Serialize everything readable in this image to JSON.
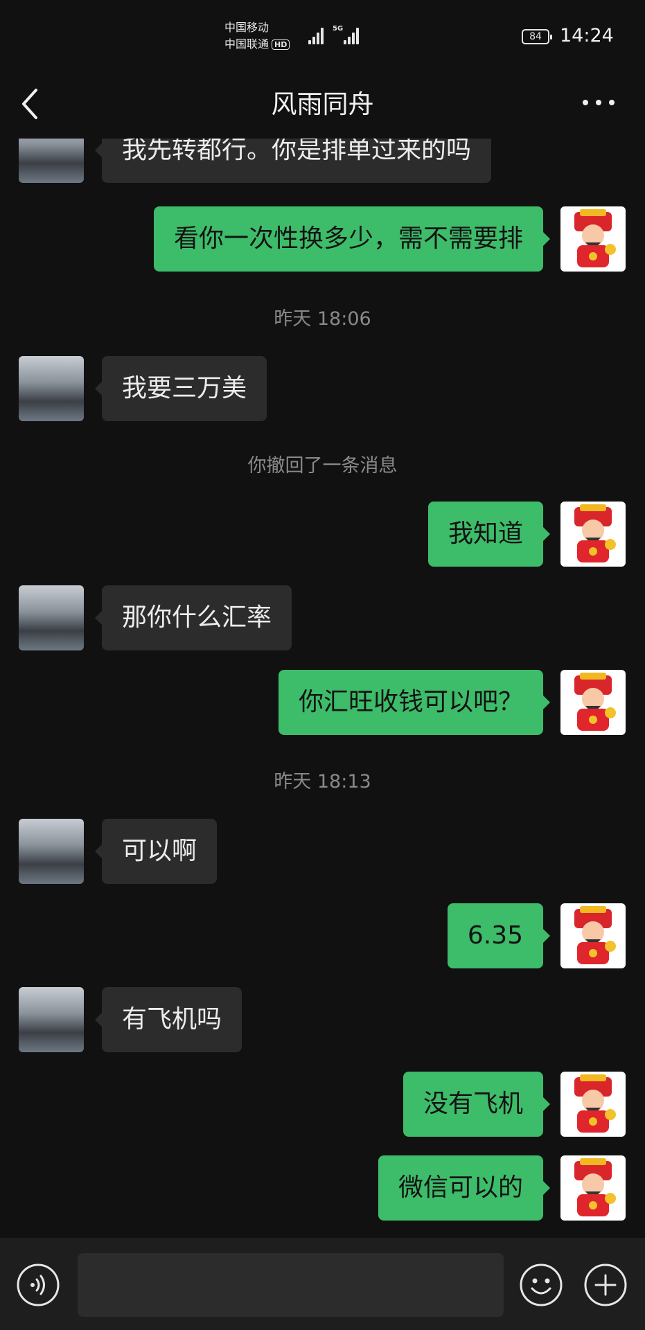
{
  "status_bar": {
    "carrier_1": "中国移动",
    "carrier_2": "中国联通",
    "hd_badge": "HD",
    "network": "5G",
    "battery": "84",
    "time": "14:24"
  },
  "header": {
    "title": "风雨同舟",
    "back_icon": "chevron-left-icon",
    "more_icon": "more-dots-icon"
  },
  "messages": [
    {
      "type": "in",
      "text": "我先转都行。你是排单过来的吗"
    },
    {
      "type": "out",
      "text": "看你一次性换多少，需不需要排"
    },
    {
      "type": "time",
      "text": "昨天 18:06"
    },
    {
      "type": "in",
      "text": "我要三万美"
    },
    {
      "type": "system",
      "text": "你撤回了一条消息"
    },
    {
      "type": "out",
      "text": "我知道"
    },
    {
      "type": "in",
      "text": "那你什么汇率"
    },
    {
      "type": "out",
      "text": "你汇旺收钱可以吧？"
    },
    {
      "type": "time",
      "text": "昨天 18:13"
    },
    {
      "type": "in",
      "text": "可以啊"
    },
    {
      "type": "out",
      "text": "6.35"
    },
    {
      "type": "in",
      "text": "有飞机吗"
    },
    {
      "type": "out",
      "text": "没有飞机"
    },
    {
      "type": "out",
      "text": "微信可以的"
    }
  ],
  "input_bar": {
    "voice_icon": "voice-icon",
    "message_value": "",
    "emoji_icon": "emoji-icon",
    "plus_icon": "plus-icon"
  },
  "colors": {
    "background": "#111111",
    "incoming_bubble": "#2c2c2c",
    "outgoing_bubble": "#3dbc6a",
    "input_bar": "#1e1e1e"
  }
}
